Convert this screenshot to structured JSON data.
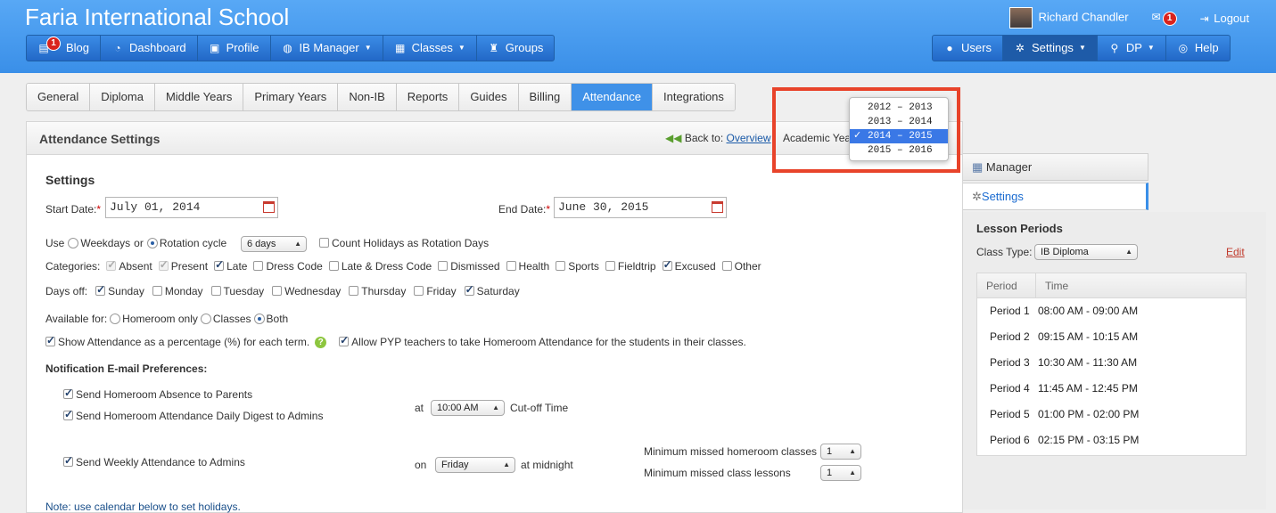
{
  "header": {
    "school_name": "Faria International School",
    "user_name": "Richard Chandler",
    "messages_badge": "1",
    "logout_label": "Logout"
  },
  "nav_left": [
    {
      "label": "Blog",
      "icon": "blog-icon",
      "badge": "1"
    },
    {
      "label": "Dashboard",
      "icon": "dashboard-icon"
    },
    {
      "label": "Profile",
      "icon": "profile-card-icon"
    },
    {
      "label": "IB Manager",
      "icon": "globe-icon",
      "caret": true
    },
    {
      "label": "Classes",
      "icon": "classes-icon",
      "caret": true
    },
    {
      "label": "Groups",
      "icon": "trophy-icon"
    }
  ],
  "nav_right": [
    {
      "label": "Users",
      "icon": "user-icon"
    },
    {
      "label": "Settings",
      "icon": "gear-icon",
      "caret": true,
      "active": true
    },
    {
      "label": "DP",
      "icon": "search-icon",
      "caret": true
    },
    {
      "label": "Help",
      "icon": "lifebuoy-icon"
    }
  ],
  "tabs": [
    "General",
    "Diploma",
    "Middle Years",
    "Primary Years",
    "Non-IB",
    "Reports",
    "Guides",
    "Billing",
    "Attendance",
    "Integrations"
  ],
  "active_tab": "Attendance",
  "panel": {
    "title": "Attendance Settings",
    "back_prefix": "Back to:",
    "back_link": "Overview",
    "academic_year_label": "Academic Year"
  },
  "academic_year_dropdown": {
    "options": [
      "2012 – 2013",
      "2013 – 2014",
      "2014 – 2015",
      "2015 – 2016"
    ],
    "selected": "2014 – 2015"
  },
  "settings": {
    "heading": "Settings",
    "start_date_label": "Start Date:",
    "start_date_value": "July 01, 2014",
    "end_date_label": "End Date:",
    "end_date_value": "June 30, 2015",
    "use_label": "Use",
    "weekdays_label": "Weekdays",
    "or_label": "or",
    "rotation_label": "Rotation cycle",
    "rotation_value": "6 days",
    "count_holidays_label": "Count Holidays as Rotation Days",
    "categories_label": "Categories:",
    "categories": [
      {
        "label": "Absent",
        "checked": true,
        "disabled": true
      },
      {
        "label": "Present",
        "checked": true,
        "disabled": true
      },
      {
        "label": "Late",
        "checked": true
      },
      {
        "label": "Dress Code",
        "checked": false
      },
      {
        "label": "Late & Dress Code",
        "checked": false
      },
      {
        "label": "Dismissed",
        "checked": false
      },
      {
        "label": "Health",
        "checked": false
      },
      {
        "label": "Sports",
        "checked": false
      },
      {
        "label": "Fieldtrip",
        "checked": false
      },
      {
        "label": "Excused",
        "checked": true
      },
      {
        "label": "Other",
        "checked": false
      }
    ],
    "days_off_label": "Days off:",
    "days": [
      {
        "label": "Sunday",
        "checked": true
      },
      {
        "label": "Monday",
        "checked": false
      },
      {
        "label": "Tuesday",
        "checked": false
      },
      {
        "label": "Wednesday",
        "checked": false
      },
      {
        "label": "Thursday",
        "checked": false
      },
      {
        "label": "Friday",
        "checked": false
      },
      {
        "label": "Saturday",
        "checked": true
      }
    ],
    "available_label": "Available for:",
    "available_options": [
      "Homeroom only",
      "Classes",
      "Both"
    ],
    "available_selected": "Both",
    "show_percentage_label": "Show Attendance as a percentage (%) for each term.",
    "allow_pyp_label": "Allow PYP teachers to take Homeroom Attendance for the students in their classes.",
    "notif_heading": "Notification E-mail Preferences:",
    "send_absence_label": "Send Homeroom Absence to Parents",
    "send_digest_label": "Send Homeroom Attendance Daily Digest to Admins",
    "at_label": "at",
    "cutoff_time": "10:00 AM",
    "cutoff_label": "Cut-off Time",
    "send_weekly_label": "Send Weekly Attendance to Admins",
    "on_label": "on",
    "weekly_day": "Friday",
    "midnight_label": "at midnight",
    "min_homeroom_label": "Minimum missed homeroom classes",
    "min_homeroom_value": "1",
    "min_class_label": "Minimum missed class lessons",
    "min_class_value": "1",
    "note": "Note: use calendar below to set holidays."
  },
  "sidebar": {
    "manager_label": "Manager",
    "settings_label": "Settings",
    "lesson_periods_heading": "Lesson Periods",
    "class_type_label": "Class Type:",
    "class_type_value": "IB Diploma",
    "edit_label": "Edit",
    "table_headers": [
      "Period",
      "Time"
    ],
    "periods": [
      {
        "period": "Period 1",
        "time": "08:00 AM - 09:00 AM"
      },
      {
        "period": "Period 2",
        "time": "09:15 AM - 10:15 AM"
      },
      {
        "period": "Period 3",
        "time": "10:30 AM - 11:30 AM"
      },
      {
        "period": "Period 4",
        "time": "11:45 AM - 12:45 PM"
      },
      {
        "period": "Period 5",
        "time": "01:00 PM - 02:00 PM"
      },
      {
        "period": "Period 6",
        "time": "02:15 PM - 03:15 PM"
      }
    ]
  },
  "colors": {
    "brand_blue": "#3a8fe8",
    "highlight_red": "#e8432a",
    "link": "#1a5aa8"
  }
}
